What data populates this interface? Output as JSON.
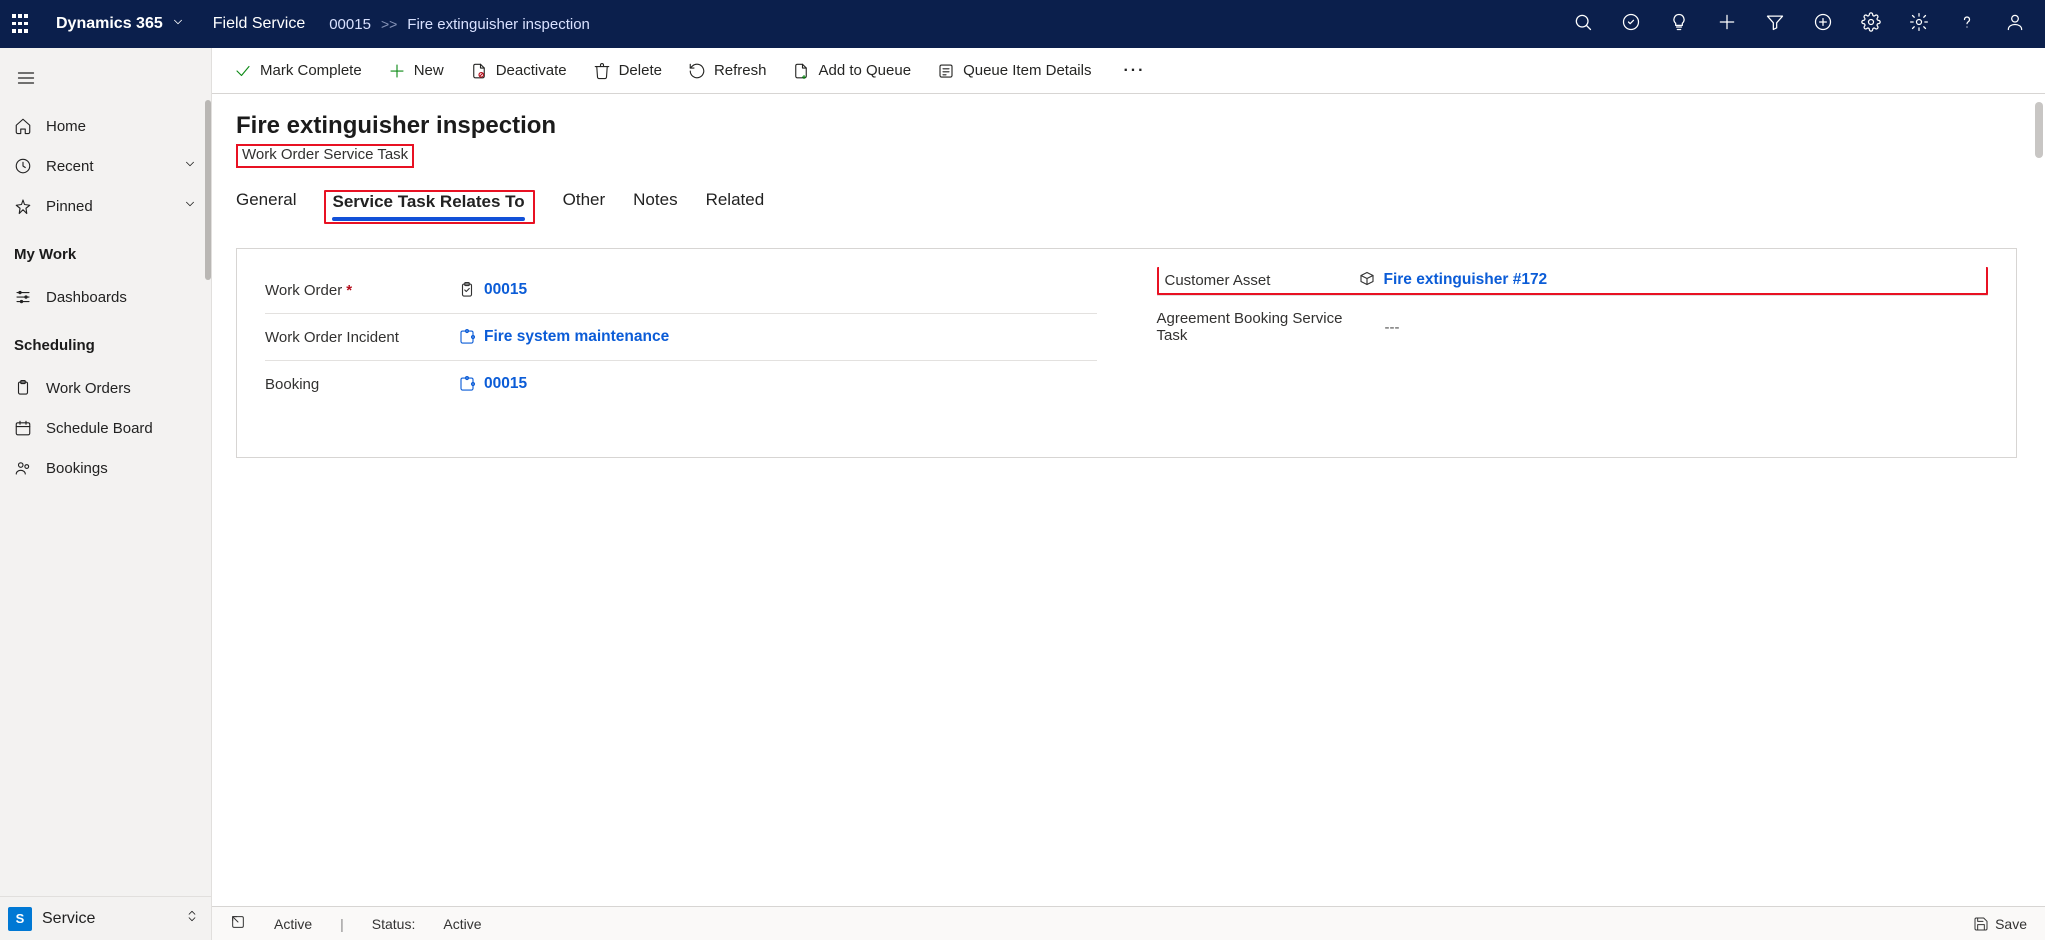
{
  "top": {
    "brand": "Dynamics 365",
    "app": "Field Service",
    "crumb_id": "00015",
    "crumb_title": "Fire extinguisher inspection"
  },
  "sidebar": {
    "items": [
      {
        "icon": "home",
        "label": "Home"
      },
      {
        "icon": "clock",
        "label": "Recent",
        "chev": true
      },
      {
        "icon": "pin",
        "label": "Pinned",
        "chev": true
      }
    ],
    "head1": "My Work",
    "group1": [
      {
        "icon": "sliders",
        "label": "Dashboards"
      }
    ],
    "head2": "Scheduling",
    "group2": [
      {
        "icon": "clipboard",
        "label": "Work Orders"
      },
      {
        "icon": "calendar",
        "label": "Schedule Board"
      },
      {
        "icon": "users",
        "label": "Bookings"
      }
    ],
    "area_badge": "S",
    "area_label": "Service"
  },
  "commands": {
    "complete": "Mark Complete",
    "new": "New",
    "deactivate": "Deactivate",
    "delete": "Delete",
    "refresh": "Refresh",
    "addqueue": "Add to Queue",
    "queuedetails": "Queue Item Details"
  },
  "page": {
    "title": "Fire extinguisher inspection",
    "subtitle": "Work Order Service Task",
    "tabs": [
      "General",
      "Service Task Relates To",
      "Other",
      "Notes",
      "Related"
    ],
    "active_tab": 1
  },
  "form": {
    "left": [
      {
        "label": "Work Order",
        "required": true,
        "icon": "clipboard",
        "value": "00015"
      },
      {
        "label": "Work Order Incident",
        "icon": "puzzle",
        "value": "Fire system maintenance"
      },
      {
        "label": "Booking",
        "icon": "puzzle",
        "value": "00015"
      }
    ],
    "right": [
      {
        "label": "Customer Asset",
        "icon": "cube",
        "value": "Fire extinguisher #172",
        "highlight": true
      },
      {
        "label": "Agreement Booking Service Task",
        "plain": "---"
      }
    ]
  },
  "status": {
    "state": "Active",
    "status_label": "Status:",
    "status_value": "Active",
    "save": "Save"
  }
}
